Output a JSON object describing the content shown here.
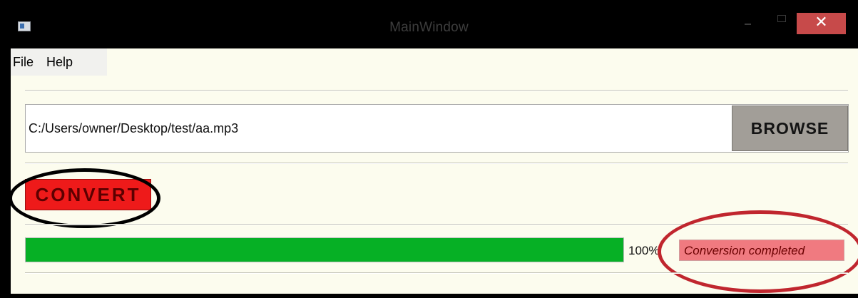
{
  "window": {
    "title": "MainWindow",
    "close_glyph": "✕",
    "icons": {
      "app": "app-window-icon",
      "minimize": "minimize-icon",
      "maximize": "maximize-icon",
      "close": "close-icon"
    }
  },
  "menu": {
    "items": [
      {
        "label": "File"
      },
      {
        "label": "Help"
      }
    ]
  },
  "file_path": {
    "value": "C:/Users/owner/Desktop/test/aa.mp3"
  },
  "buttons": {
    "browse_label": "BROWSE",
    "convert_label": "CONVERT"
  },
  "progress": {
    "fraction": 1.0,
    "label": "100%"
  },
  "status": {
    "text": "Conversion completed"
  },
  "colors": {
    "client_background": "#fcfcee",
    "convert_button": "#ee1a1a",
    "browse_button": "#a29e98",
    "progress_fill": "#06b025",
    "status_background": "#f07a80",
    "close_button": "#c74a4a",
    "convert_annotation": "#000000",
    "status_annotation": "#c0262e"
  }
}
